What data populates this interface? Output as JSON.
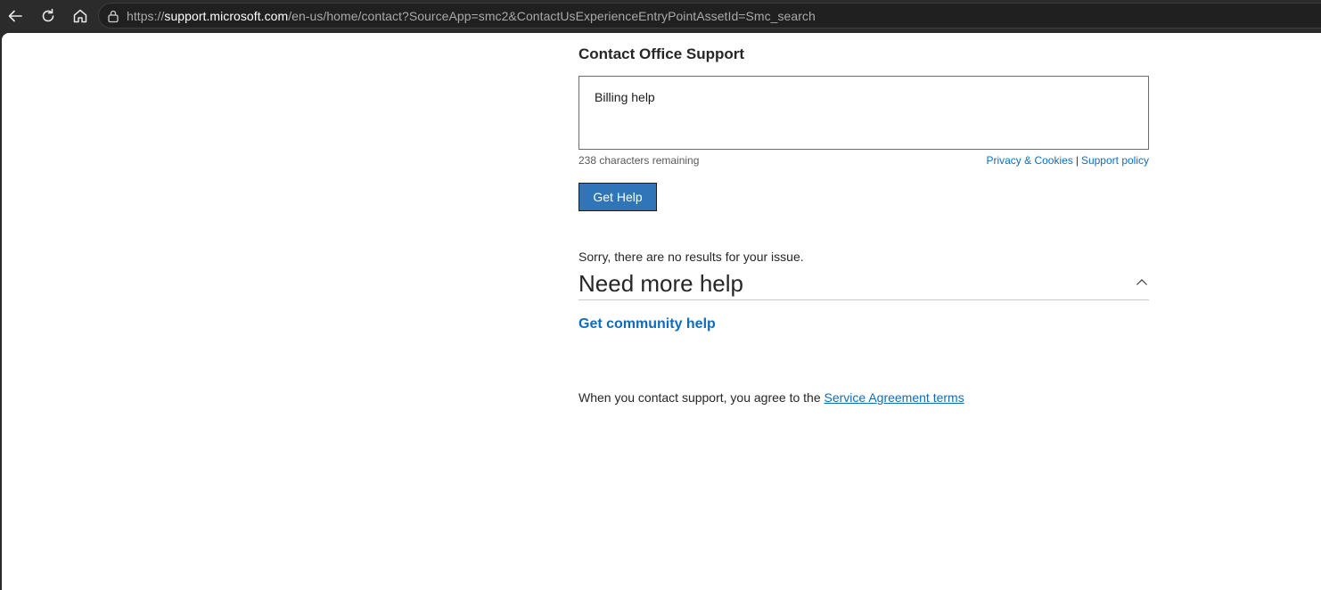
{
  "browser": {
    "address_host_prefix": "https://",
    "address_host": "support.microsoft.com",
    "address_path": "/en-us/home/contact?SourceApp=smc2&ContactUsExperienceEntryPointAssetId=Smc_search",
    "icons": [
      "back-arrow-icon",
      "refresh-icon",
      "home-icon",
      "lock-icon"
    ]
  },
  "contact": {
    "title": "Contact Office Support",
    "issue_text": "Billing help",
    "chars_remaining": "238 characters remaining",
    "privacy_link": "Privacy & Cookies",
    "separator": "|",
    "support_policy_link": "Support policy",
    "get_help_label": "Get Help",
    "no_results": "Sorry, there are no results for your issue.",
    "more_help_title": "Need more help",
    "community_link": "Get community help",
    "agreement_text": "When you contact support, you agree to the ",
    "agreement_link": "Service Agreement terms"
  },
  "colors": {
    "link": "#0f6cbd",
    "button": "#2f75b8",
    "chrome": "#2b2b2b"
  }
}
